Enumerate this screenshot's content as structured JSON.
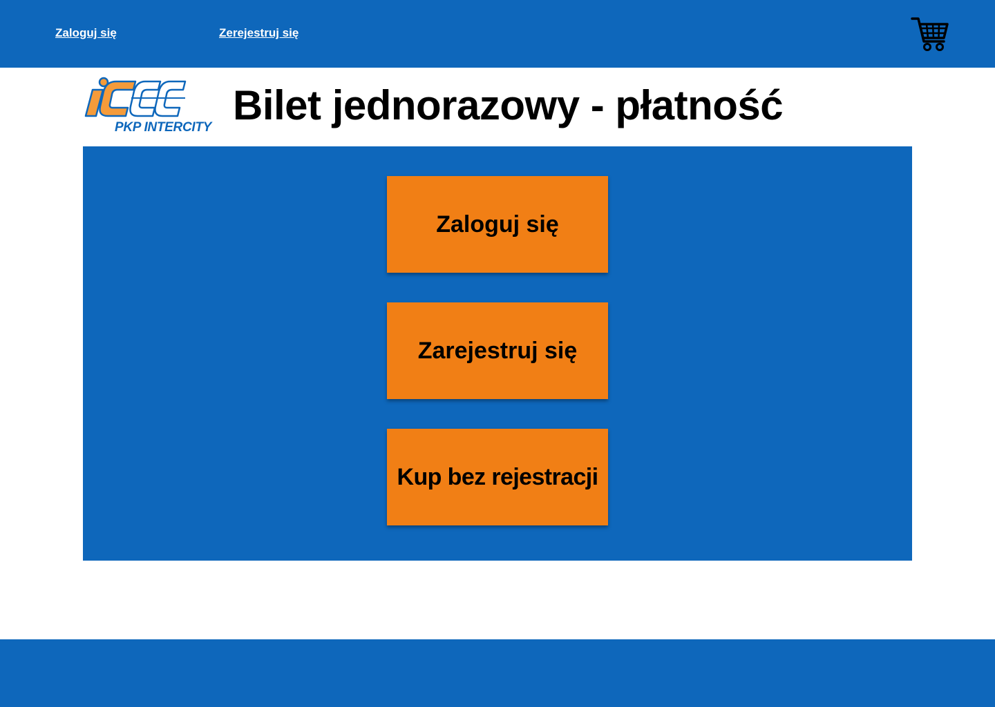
{
  "header": {
    "login_link": "Zaloguj się",
    "register_link": "Zerejestruj się",
    "cart_icon": "shopping-cart-icon"
  },
  "logo": {
    "brand_text": "PKP INTERCITY",
    "icon": "ic-logo-icon"
  },
  "page": {
    "title": "Bilet jednorazowy - płatność"
  },
  "actions": {
    "login_label": "Zaloguj się",
    "register_label": "Zarejestruj się",
    "guest_label": "Kup bez rejestracji"
  },
  "colors": {
    "primary_blue": "#0e67bb",
    "accent_orange": "#f17f15",
    "background": "#ffffff"
  }
}
